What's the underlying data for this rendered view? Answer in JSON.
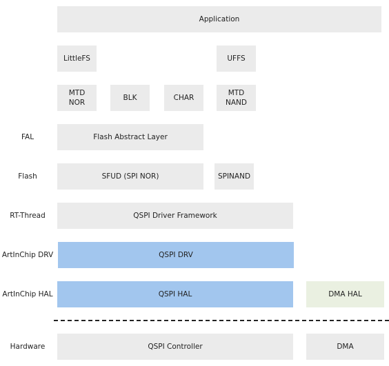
{
  "colors": {
    "gray": "#ebebeb",
    "blue": "#a2c6ee",
    "green": "#eaf0e1"
  },
  "layers": {
    "fal": "FAL",
    "flash": "Flash",
    "rtthread": "RT-Thread",
    "drv": "ArtInChip DRV",
    "hal": "ArtInChip HAL",
    "hardware": "Hardware"
  },
  "blocks": {
    "application": "Application",
    "littlefs": "LittleFS",
    "uffs": "UFFS",
    "mtd_nor": "MTD\nNOR",
    "blk": "BLK",
    "char": "CHAR",
    "mtd_nand": "MTD\nNAND",
    "fal": "Flash Abstract Layer",
    "sfud": "SFUD (SPI NOR)",
    "spinand": "SPINAND",
    "qspi_framework": "QSPI Driver Framework",
    "qspi_drv": "QSPI DRV",
    "qspi_hal": "QSPI HAL",
    "dma_hal": "DMA HAL",
    "qspi_controller": "QSPI Controller",
    "dma": "DMA"
  }
}
